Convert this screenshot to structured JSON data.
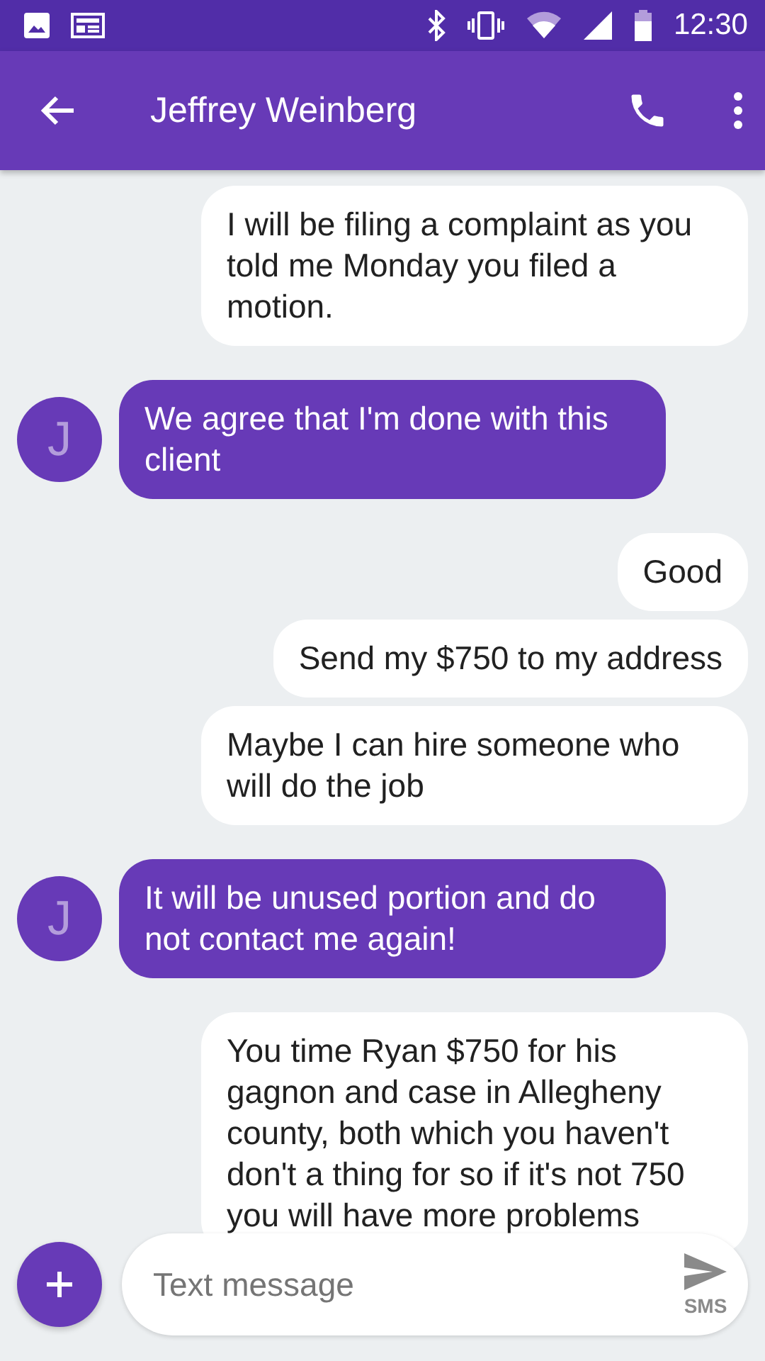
{
  "status_bar": {
    "time": "12:30"
  },
  "app_bar": {
    "title": "Jeffrey Weinberg"
  },
  "messages": [
    {
      "kind": "outgoing",
      "text": "I will be filing a complaint as you told me Monday you filed a motion."
    },
    {
      "kind": "incoming",
      "avatar": "J",
      "text": "We agree that I'm done with this client"
    },
    {
      "kind": "outgoing",
      "text": "Good"
    },
    {
      "kind": "outgoing",
      "text": "Send my $750 to my address"
    },
    {
      "kind": "outgoing",
      "text": "Maybe I can hire someone who will do the job"
    },
    {
      "kind": "incoming",
      "avatar": "J",
      "text": "It will be unused portion and do not contact me again!"
    },
    {
      "kind": "outgoing",
      "text": "You time Ryan $750 for his gagnon and case in Allegheny county, both which you haven't don't a thing for so if it's not 750 you will have more problems"
    }
  ],
  "composer": {
    "placeholder": "Text message",
    "send_label": "SMS"
  }
}
